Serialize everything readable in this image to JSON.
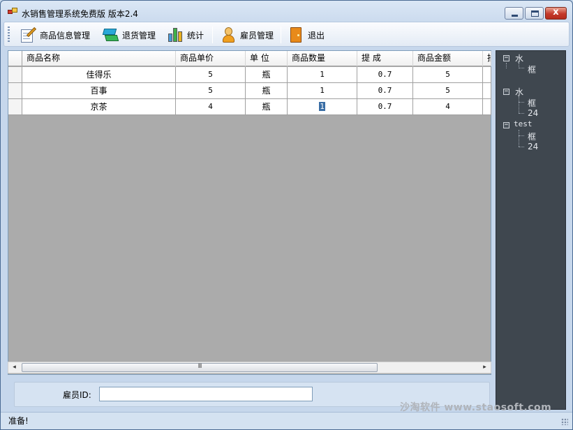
{
  "window": {
    "title": "水销售管理系统免费版 版本2.4",
    "close_glyph": "x"
  },
  "toolbar": {
    "items": [
      {
        "label": "商品信息管理",
        "icon": "edit-notepad-icon"
      },
      {
        "label": "退货管理",
        "icon": "return-goods-icon"
      },
      {
        "label": "统计",
        "icon": "statistics-chart-icon"
      },
      {
        "label": "雇员管理",
        "icon": "employee-user-icon"
      },
      {
        "label": "退出",
        "icon": "exit-door-icon"
      }
    ]
  },
  "grid": {
    "columns": [
      "商品名称",
      "商品单价",
      "单 位",
      "商品数量",
      "提 成",
      "商品金额",
      "抽"
    ],
    "rows": [
      {
        "name": "佳得乐",
        "price": "5",
        "unit": "瓶",
        "qty": "1",
        "commission": "0.7",
        "amount": "5"
      },
      {
        "name": "百事",
        "price": "5",
        "unit": "瓶",
        "qty": "1",
        "commission": "0.7",
        "amount": "5"
      },
      {
        "name": "京茶",
        "price": "4",
        "unit": "瓶",
        "qty": "1",
        "commission": "0.7",
        "amount": "4"
      }
    ]
  },
  "scrollbar": {
    "left_arrow": "◂",
    "right_arrow": "▸",
    "grip": "III"
  },
  "employee": {
    "label": "雇员ID:",
    "value": ""
  },
  "tree": {
    "nodes": [
      {
        "label": "水",
        "children": [
          "框"
        ]
      },
      {
        "label": "水",
        "children": [
          "框",
          "24"
        ]
      },
      {
        "label": "test",
        "children": [
          "框",
          "24"
        ]
      }
    ],
    "expander": "−"
  },
  "status": {
    "text": "准备!"
  },
  "watermark": "沙淘软件 www.staosoft.com",
  "colors": {
    "grid_background": "#ababab",
    "tree_background": "#3f474f",
    "selection": "#3a6ea5"
  }
}
